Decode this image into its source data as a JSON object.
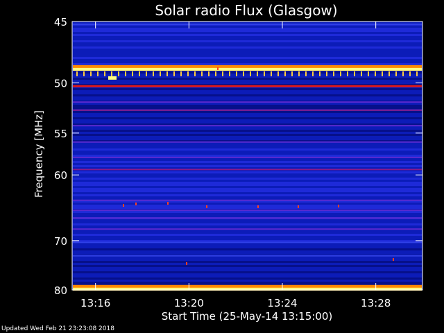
{
  "chart_data": {
    "type": "heatmap",
    "title": "Solar radio Flux (Glasgow)",
    "xlabel": "Start Time (25-May-14 13:15:00)",
    "ylabel": "Frequency [MHz]",
    "x_ticks": [
      "13:16",
      "13:20",
      "13:24",
      "13:28"
    ],
    "x_tick_minutes": [
      1,
      5,
      9,
      13
    ],
    "xlim_minutes": [
      0,
      15
    ],
    "y_ticks": [
      45,
      50,
      55,
      60,
      70,
      80
    ],
    "ylim": [
      45,
      80
    ],
    "y_scale": "reciprocal",
    "intensity_bands": [
      {
        "freq": 45.2,
        "level": 0.1
      },
      {
        "freq": 48.8,
        "level": 1.0
      },
      {
        "freq": 50.3,
        "level": 0.75
      },
      {
        "freq": 51.8,
        "level": 0.4
      },
      {
        "freq": 52.6,
        "level": 0.45
      },
      {
        "freq": 54.2,
        "level": 0.4
      },
      {
        "freq": 56.0,
        "level": 0.4
      },
      {
        "freq": 57.8,
        "level": 0.4
      },
      {
        "freq": 59.3,
        "level": 0.5
      },
      {
        "freq": 63.5,
        "level": 0.3
      },
      {
        "freq": 65.0,
        "level": 0.35
      },
      {
        "freq": 66.2,
        "level": 0.3
      },
      {
        "freq": 68.0,
        "level": 0.3
      },
      {
        "freq": 70.3,
        "level": 0.25
      },
      {
        "freq": 72.8,
        "level": 0.25
      },
      {
        "freq": 79.8,
        "level": 1.0
      }
    ],
    "colors": {
      "background": "#000000",
      "low": "#0a1ab0",
      "mid": "#c8005a",
      "high": "#ffff80"
    }
  },
  "footer": {
    "updated": "Updated Wed Feb 21 23:23:08 2018"
  }
}
